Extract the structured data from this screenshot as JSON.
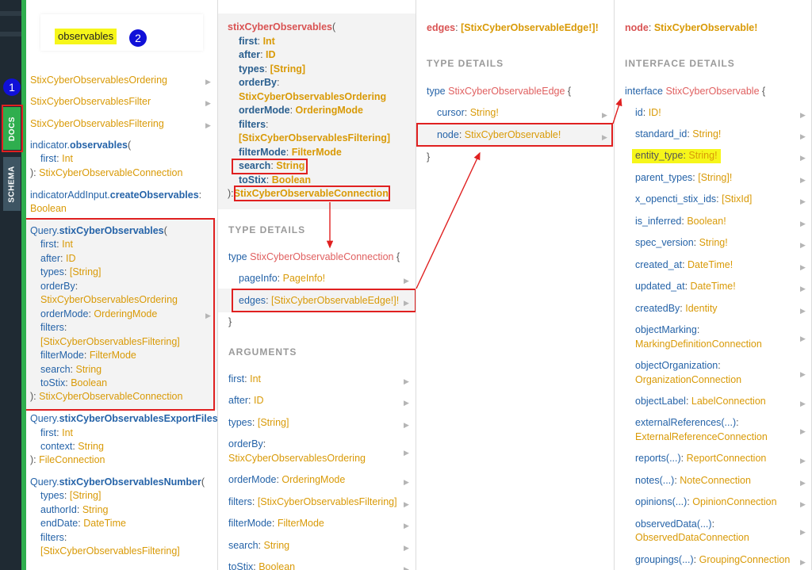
{
  "sidebar": {
    "docs_label": "DOCS",
    "schema_label": "SCHEMA"
  },
  "badges": {
    "one": "1",
    "two": "2"
  },
  "search": {
    "value": "observables"
  },
  "col1": {
    "items": [
      {
        "text": "StixCyberObservablesOrdering"
      },
      {
        "text": "StixCyberObservablesFilter"
      },
      {
        "text": "StixCyberObservablesFiltering"
      }
    ],
    "ind_obs": {
      "owner": "indicator.",
      "name": "observables",
      "paren": "(",
      "arg_name": "first",
      "arg_type": "Int",
      "ret_prefix": "): ",
      "ret_type": "StixCyberObservableConnection"
    },
    "ind_add": {
      "owner": "indicatorAddInput.",
      "name": "createObservables",
      "colon": ":",
      "ret_type": "Boolean"
    },
    "query_obs": {
      "owner": "Query.",
      "name": "stixCyberObservables",
      "paren": "(",
      "args": [
        {
          "name": "first",
          "type": "Int"
        },
        {
          "name": "after",
          "type": "ID"
        },
        {
          "name": "types",
          "type": "[String]"
        },
        {
          "name": "orderBy",
          "type": "StixCyberObservablesOrdering"
        },
        {
          "name": "orderMode",
          "type": "OrderingMode"
        },
        {
          "name": "filters",
          "type": "[StixCyberObservablesFiltering]"
        },
        {
          "name": "filterMode",
          "type": "FilterMode"
        },
        {
          "name": "search",
          "type": "String"
        },
        {
          "name": "toStix",
          "type": "Boolean"
        }
      ],
      "ret_prefix": "): ",
      "ret_type": "StixCyberObservableConnection"
    },
    "query_export": {
      "owner": "Query.",
      "name": "stixCyberObservablesExportFiles",
      "paren": "(",
      "args": [
        {
          "name": "first",
          "type": "Int"
        },
        {
          "name": "context",
          "type": "String"
        }
      ],
      "ret_prefix": "): ",
      "ret_type": "FileConnection"
    },
    "query_number": {
      "owner": "Query.",
      "name": "stixCyberObservablesNumber",
      "paren": "(",
      "args": [
        {
          "name": "types",
          "type": "[String]"
        },
        {
          "name": "authorId",
          "type": "String"
        },
        {
          "name": "endDate",
          "type": "DateTime"
        },
        {
          "name": "filters",
          "type": "[StixCyberObservablesFiltering]"
        }
      ]
    }
  },
  "col2": {
    "header": {
      "name": "stixCyberObservables",
      "paren": "(",
      "args": [
        {
          "name": "first",
          "type": "Int"
        },
        {
          "name": "after",
          "type": "ID"
        },
        {
          "name": "types",
          "type": "[String]"
        },
        {
          "name": "orderBy",
          "type": "StixCyberObservablesOrdering"
        },
        {
          "name": "orderMode",
          "type": "OrderingMode"
        },
        {
          "name": "filters",
          "type": "[StixCyberObservablesFiltering]"
        },
        {
          "name": "filterMode",
          "type": "FilterMode"
        },
        {
          "name": "search",
          "type": "String"
        },
        {
          "name": "toStix",
          "type": "Boolean"
        }
      ],
      "ret_prefix": "):",
      "ret_type": "StixCyberObservableConnection"
    },
    "type_details_label": "TYPE DETAILS",
    "type_decl": {
      "kw": "type",
      "name": "StixCyberObservableConnection",
      "brace": "{"
    },
    "fields": [
      {
        "name": "pageInfo",
        "type": "PageInfo!"
      },
      {
        "name": "edges",
        "type": "[StixCyberObservableEdge!]!"
      }
    ],
    "close_brace": "}",
    "arguments_label": "ARGUMENTS",
    "arguments": [
      {
        "name": "first",
        "type": "Int"
      },
      {
        "name": "after",
        "type": "ID"
      },
      {
        "name": "types",
        "type": "[String]"
      },
      {
        "name": "orderBy",
        "type": "StixCyberObservablesOrdering"
      },
      {
        "name": "orderMode",
        "type": "OrderingMode"
      },
      {
        "name": "filters",
        "type": "[StixCyberObservablesFiltering]"
      },
      {
        "name": "filterMode",
        "type": "FilterMode"
      },
      {
        "name": "search",
        "type": "String"
      },
      {
        "name": "toStix",
        "type": "Boolean"
      }
    ]
  },
  "col3": {
    "header": {
      "name": "edges",
      "type": "[StixCyberObservableEdge!]!"
    },
    "type_details_label": "TYPE DETAILS",
    "type_decl": {
      "kw": "type",
      "name": "StixCyberObservableEdge",
      "brace": "{"
    },
    "fields": [
      {
        "name": "cursor",
        "type": "String!"
      },
      {
        "name": "node",
        "type": "StixCyberObservable!"
      }
    ],
    "close_brace": "}"
  },
  "col4": {
    "header": {
      "name": "node",
      "type": "StixCyberObservable!"
    },
    "details_label": "INTERFACE DETAILS",
    "decl": {
      "kw": "interface",
      "name": "StixCyberObservable",
      "brace": "{"
    },
    "fields": [
      {
        "name": "id",
        "type": "ID!"
      },
      {
        "name": "standard_id",
        "type": "String!"
      },
      {
        "name": "entity_type",
        "type": "String!"
      },
      {
        "name": "parent_types",
        "type": "[String]!"
      },
      {
        "name": "x_opencti_stix_ids",
        "type": "[StixId]"
      },
      {
        "name": "is_inferred",
        "type": "Boolean!"
      },
      {
        "name": "spec_version",
        "type": "String!"
      },
      {
        "name": "created_at",
        "type": "DateTime!"
      },
      {
        "name": "updated_at",
        "type": "DateTime!"
      },
      {
        "name": "createdBy",
        "type": "Identity"
      },
      {
        "name": "objectMarking",
        "type": "MarkingDefinitionConnection"
      },
      {
        "name": "objectOrganization",
        "type": "OrganizationConnection"
      },
      {
        "name": "objectLabel",
        "type": "LabelConnection"
      },
      {
        "name": "externalReferences(...)",
        "type": "ExternalReferenceConnection"
      },
      {
        "name": "reports(...)",
        "type": "ReportConnection"
      },
      {
        "name": "notes(...)",
        "type": "NoteConnection"
      },
      {
        "name": "opinions(...)",
        "type": "OpinionConnection"
      },
      {
        "name": "observedData(...)",
        "type": "ObservedDataConnection"
      },
      {
        "name": "groupings(...)",
        "type": "GroupingConnection"
      }
    ]
  },
  "colors": {
    "accent_green": "#2fae4e",
    "annotation_red": "#e02020",
    "highlight_yellow": "#f6f61a",
    "badge_blue": "#1010d8"
  }
}
